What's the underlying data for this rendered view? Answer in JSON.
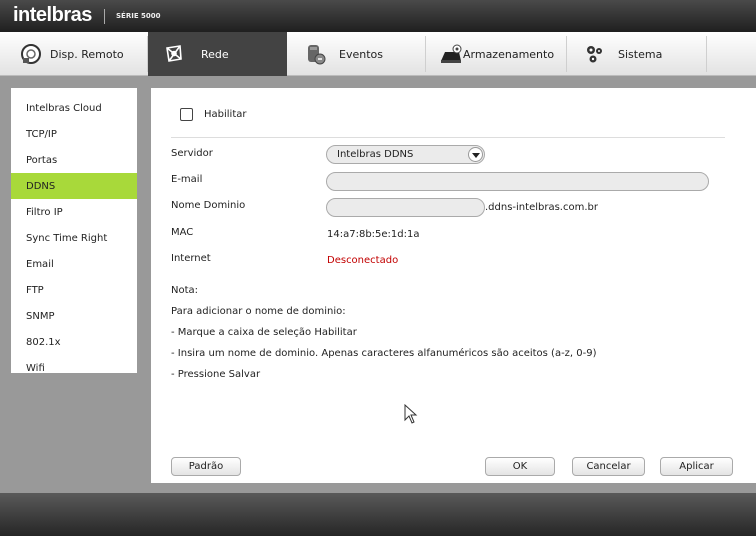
{
  "header": {
    "brand": "intelbras",
    "series": "SÉRIE 5000"
  },
  "nav": {
    "items": [
      {
        "label": "Disp. Remoto",
        "icon": "remote-device-icon"
      },
      {
        "label": "Rede",
        "icon": "network-icon"
      },
      {
        "label": "Eventos",
        "icon": "events-icon"
      },
      {
        "label": "Armazenamento",
        "icon": "storage-icon"
      },
      {
        "label": "Sistema",
        "icon": "gears-icon"
      }
    ],
    "active": "Rede"
  },
  "sidebar": {
    "items": [
      {
        "label": "Intelbras Cloud"
      },
      {
        "label": "TCP/IP"
      },
      {
        "label": "Portas"
      },
      {
        "label": "DDNS"
      },
      {
        "label": "Filtro IP"
      },
      {
        "label": "Sync Time Right"
      },
      {
        "label": "Email"
      },
      {
        "label": "FTP"
      },
      {
        "label": "SNMP"
      },
      {
        "label": "802.1x"
      },
      {
        "label": "Wifi"
      }
    ],
    "active": "DDNS"
  },
  "form": {
    "enable_label": "Habilitar",
    "enabled": false,
    "server_label": "Servidor",
    "server_value": "Intelbras DDNS",
    "email_label": "E-mail",
    "email_value": "",
    "domain_label": "Nome Dominio",
    "domain_value": "",
    "domain_suffix": ".ddns-intelbras.com.br",
    "mac_label": "MAC",
    "mac_value": "14:a7:8b:5e:1d:1a",
    "internet_label": "Internet",
    "internet_value": "Desconectado",
    "internet_color": "#c20000"
  },
  "note": {
    "title": "Nota:",
    "lines": [
      "Para adicionar o nome de dominio:",
      "- Marque a caixa de seleção Habilitar",
      "- Insira um nome de dominio. Apenas caracteres alfanuméricos são aceitos (a-z, 0-9)",
      "- Pressione Salvar"
    ]
  },
  "buttons": {
    "default": "Padrão",
    "ok": "OK",
    "cancel": "Cancelar",
    "apply": "Aplicar"
  },
  "colors": {
    "active_sidebar": "#a8d93a",
    "active_nav": "#434343"
  }
}
